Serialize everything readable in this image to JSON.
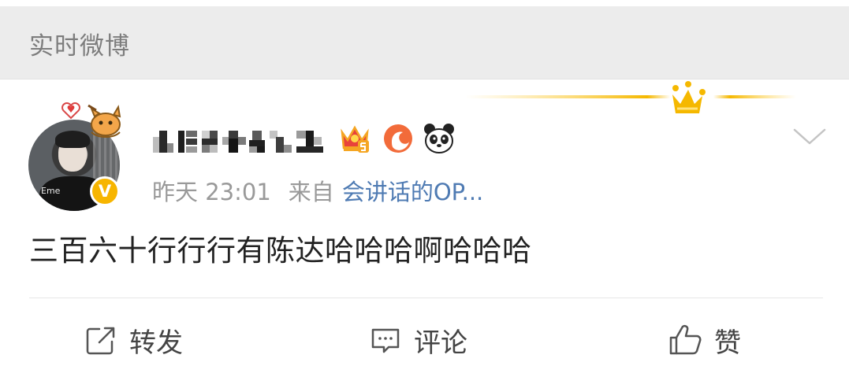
{
  "header": {
    "title": "实时微博"
  },
  "post": {
    "avatar_tag": "Eme",
    "verified_label": "V",
    "time": "昨天 23:01",
    "source_prefix": "来自",
    "source": "会讲话的OP...",
    "content": "三百六十行行行有陈达哈哈哈啊哈哈哈",
    "badges": [
      "crown-vip-icon",
      "bird-fan-icon",
      "panda-icon"
    ]
  },
  "actions": {
    "repost": "转发",
    "comment": "评论",
    "like": "赞"
  },
  "colors": {
    "header_bg": "#ececec",
    "link": "#4f7bb3",
    "verified": "#f7b500",
    "meta": "#999999"
  }
}
